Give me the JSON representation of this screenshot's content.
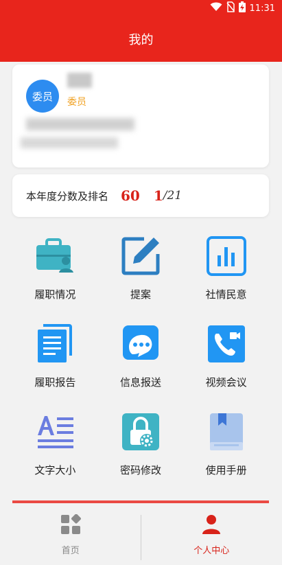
{
  "status_bar": {
    "time": "11:31"
  },
  "header": {
    "title": "我的"
  },
  "profile": {
    "avatar_text": "委员",
    "role": "委员"
  },
  "score": {
    "label": "本年度分数及排名",
    "value": "60",
    "rank": "1",
    "rank_total": "/21"
  },
  "grid": [
    {
      "label": "履职情况",
      "icon": "briefcase-person-icon"
    },
    {
      "label": "提案",
      "icon": "edit-icon"
    },
    {
      "label": "社情民意",
      "icon": "bar-chart-icon"
    },
    {
      "label": "履职报告",
      "icon": "document-icon"
    },
    {
      "label": "信息报送",
      "icon": "chat-bubble-icon"
    },
    {
      "label": "视频会议",
      "icon": "video-call-icon"
    },
    {
      "label": "文字大小",
      "icon": "text-size-icon"
    },
    {
      "label": "密码修改",
      "icon": "lock-gear-icon"
    },
    {
      "label": "使用手册",
      "icon": "manual-book-icon"
    }
  ],
  "tabs": [
    {
      "label": "首页",
      "icon": "apps-grid-icon"
    },
    {
      "label": "个人中心",
      "icon": "person-icon"
    }
  ],
  "colors": {
    "primary_red": "#e8251c",
    "icon_blue": "#2196f3",
    "teal": "#3fb3c4",
    "accent_orange": "#f0a020"
  }
}
